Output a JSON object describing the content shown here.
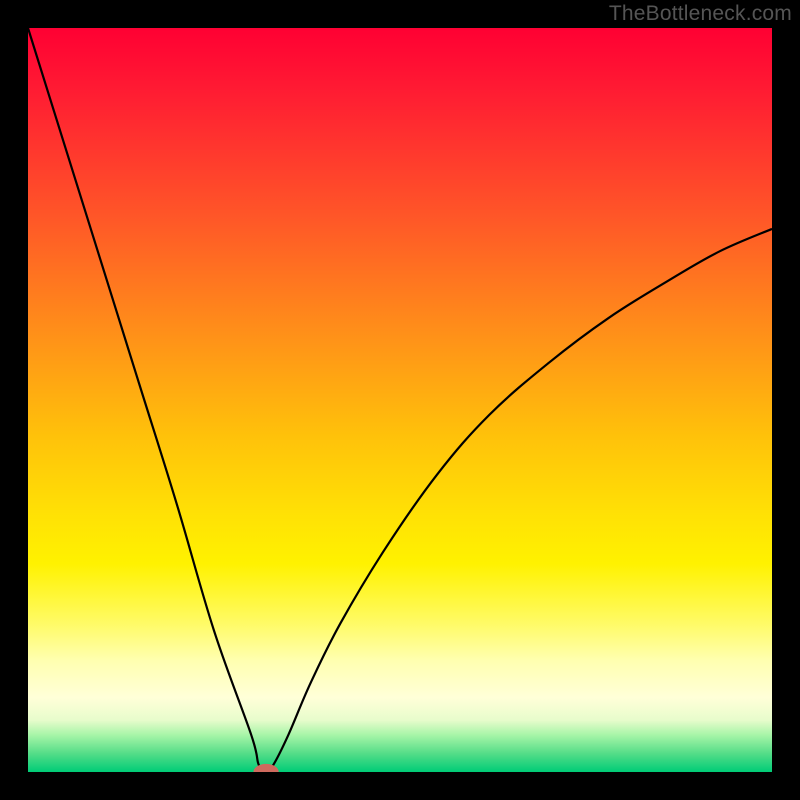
{
  "watermark": "TheBottleneck.com",
  "chart_data": {
    "type": "line",
    "title": "",
    "xlabel": "",
    "ylabel": "",
    "xlim": [
      0,
      100
    ],
    "ylim": [
      0,
      100
    ],
    "background_gradient_stops": [
      {
        "pct": 0,
        "color": "#ff0033"
      },
      {
        "pct": 8,
        "color": "#ff1a33"
      },
      {
        "pct": 25,
        "color": "#ff5528"
      },
      {
        "pct": 40,
        "color": "#ff8c1a"
      },
      {
        "pct": 55,
        "color": "#ffc20a"
      },
      {
        "pct": 65,
        "color": "#ffe005"
      },
      {
        "pct": 72,
        "color": "#fff200"
      },
      {
        "pct": 80,
        "color": "#fffb66"
      },
      {
        "pct": 85,
        "color": "#ffffb0"
      },
      {
        "pct": 90,
        "color": "#ffffd8"
      },
      {
        "pct": 93,
        "color": "#e8fccc"
      },
      {
        "pct": 95,
        "color": "#a8f5a8"
      },
      {
        "pct": 97.5,
        "color": "#55dd88"
      },
      {
        "pct": 100,
        "color": "#00cc77"
      }
    ],
    "series": [
      {
        "name": "curve",
        "x": [
          0,
          5,
          10,
          15,
          20,
          25,
          30,
          31,
          32,
          33,
          35,
          38,
          42,
          48,
          55,
          62,
          70,
          78,
          86,
          93,
          100
        ],
        "y": [
          100,
          84,
          68,
          52,
          36,
          19,
          5,
          1,
          0,
          1,
          5,
          12,
          20,
          30,
          40,
          48,
          55,
          61,
          66,
          70,
          73
        ]
      }
    ],
    "marker": {
      "x": 32,
      "y": 0,
      "color": "#cf6a5e",
      "rx": 1.7,
      "ry": 1.1
    }
  }
}
